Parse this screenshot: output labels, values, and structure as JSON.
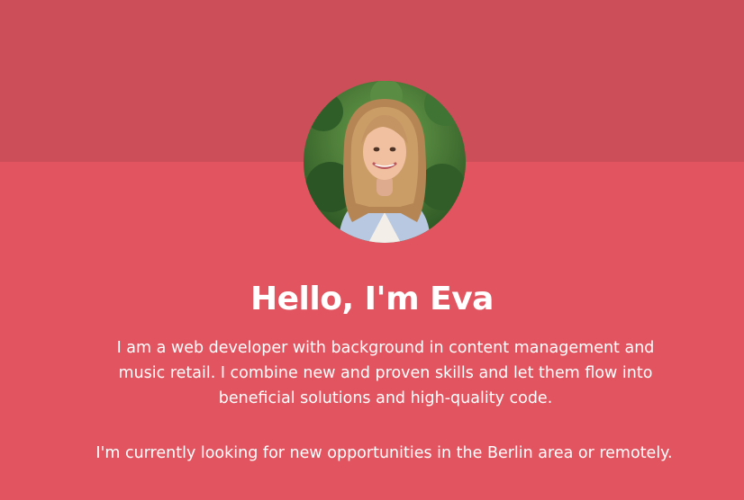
{
  "hero": {
    "avatar_icon": "profile-photo",
    "heading": "Hello, I'm Eva",
    "intro": "I am a web developer with background in content management and music retail. I combine new and proven skills and let them flow into beneficial solutions and high-quality code.",
    "availability": "I'm currently looking for new opportunities in the Berlin area or remotely."
  },
  "colors": {
    "top_band": "#cb4e58",
    "background": "#e2545f",
    "text": "#ffffff"
  }
}
